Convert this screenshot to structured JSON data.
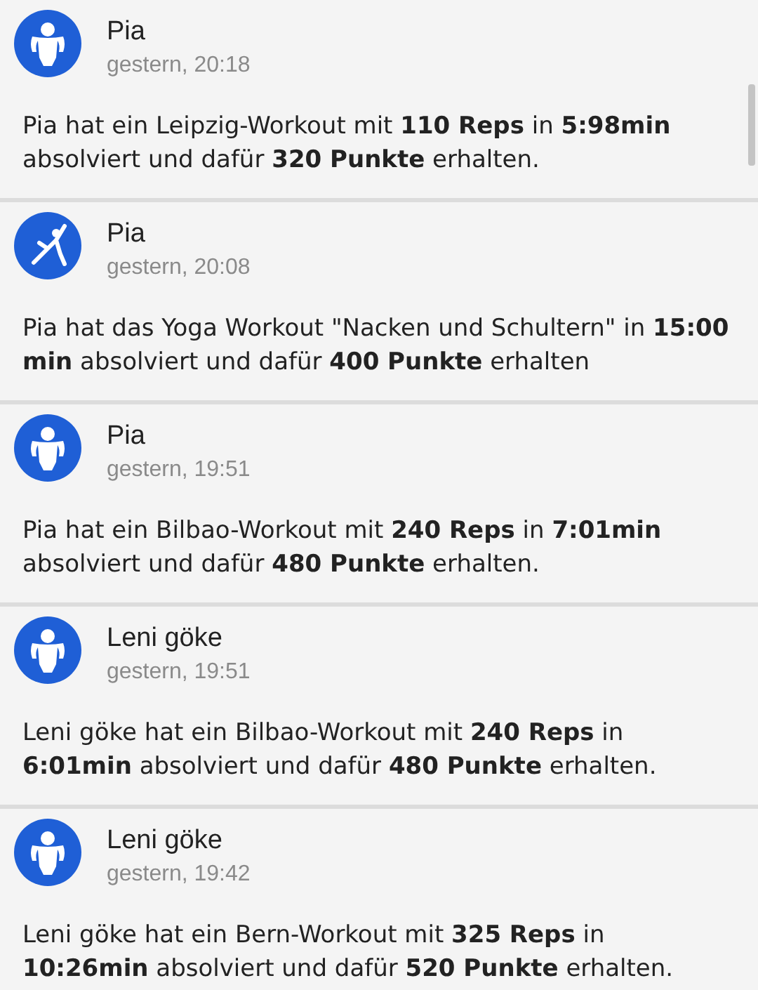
{
  "feed": [
    {
      "kind": "workout",
      "name": "Pia",
      "time": "gestern, 20:18",
      "message": "Pia hat ein Leipzig-Workout mit **110 Reps** in **5:98min** absolviert und dafür **320 Punkte** erhalten."
    },
    {
      "kind": "yoga",
      "name": "Pia",
      "time": "gestern, 20:08",
      "message": "Pia hat das Yoga Workout \"Nacken und Schultern\" in **15:00 min** absolviert und dafür **400 Punkte** erhalten"
    },
    {
      "kind": "workout",
      "name": "Pia",
      "time": "gestern, 19:51",
      "message": "Pia hat ein Bilbao-Workout mit **240 Reps** in **7:01min** absolviert und dafür **480 Punkte** erhalten."
    },
    {
      "kind": "workout",
      "name": "Leni göke",
      "time": "gestern, 19:51",
      "message": "Leni göke hat ein Bilbao-Workout mit **240 Reps** in **6:01min** absolviert und dafür **480 Punkte** erhalten."
    },
    {
      "kind": "workout",
      "name": "Leni göke",
      "time": "gestern, 19:42",
      "message": "Leni göke hat ein Bern-Workout mit **325 Reps** in **10:26min** absolviert und dafür **520 Punkte** erhalten."
    }
  ]
}
